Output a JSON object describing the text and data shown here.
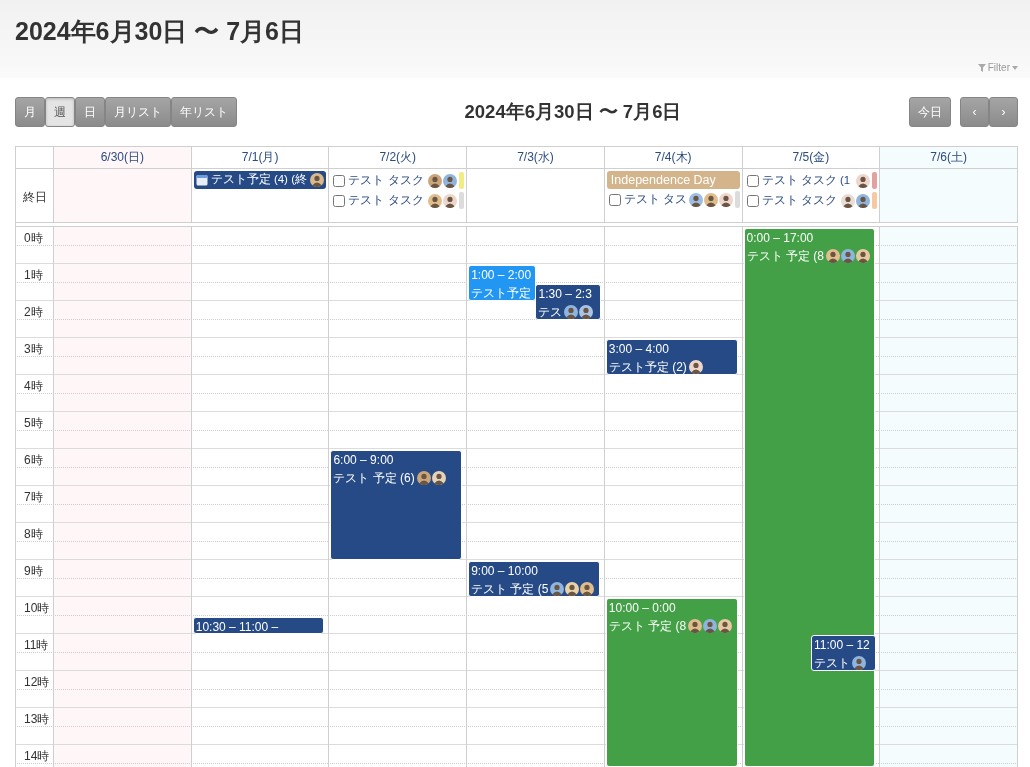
{
  "header": {
    "title": "2024年6月30日 〜 7月6日",
    "filter": "Filter"
  },
  "toolbar": {
    "views": [
      {
        "label": "月",
        "selected": false
      },
      {
        "label": "週",
        "selected": true
      },
      {
        "label": "日",
        "selected": false
      },
      {
        "label": "月リスト",
        "selected": false
      },
      {
        "label": "年リスト",
        "selected": false
      }
    ],
    "title": "2024年6月30日 〜 7月6日",
    "today": "今日",
    "nav": [
      "‹",
      "›"
    ]
  },
  "calendar": {
    "allday_label": "終日",
    "hours": [
      "0時",
      "1時",
      "2時",
      "3時",
      "4時",
      "5時",
      "6時",
      "7時",
      "8時",
      "9時",
      "10時",
      "11時",
      "12時",
      "13時",
      "14時"
    ],
    "days": [
      {
        "label": "6/30(日)",
        "kind": "sunday"
      },
      {
        "label": "7/1(月)",
        "kind": "weekday",
        "allday": [
          {
            "kind": "event",
            "title": "テスト予定 (4) (終",
            "color": "#254a86",
            "avatars": [
              {
                "color": "#d9b98c"
              }
            ]
          }
        ],
        "events": [
          {
            "time": "10:30 – 11:00 –",
            "color": "#254a86"
          }
        ]
      },
      {
        "label": "7/2(火)",
        "kind": "weekday",
        "allday": [
          {
            "kind": "task",
            "title": "テスト タスク",
            "checked": false,
            "color": "#f2ec84",
            "avatars": [
              {
                "color": "#caa57a"
              },
              {
                "color": "#8fb4de"
              }
            ]
          },
          {
            "kind": "task",
            "title": "テスト タスク",
            "checked": false,
            "color": "#dcdcdc",
            "avatars": [
              {
                "color": "#e0bd8c"
              },
              {
                "color": "#efd6cc"
              }
            ]
          }
        ],
        "events": [
          {
            "time": "6:00 – 9:00",
            "title": "テスト 予定 (6)",
            "color": "#254a86",
            "avatars": [
              {
                "color": "#caa57a"
              },
              {
                "color": "#e6d3b8"
              }
            ]
          }
        ]
      },
      {
        "label": "7/3(水)",
        "kind": "weekday",
        "events": [
          {
            "time": "1:00 – 2:00",
            "title": "テスト予定",
            "color": "#2196f3"
          },
          {
            "time": "1:30 – 2:3",
            "title": "テス",
            "color": "#254a86",
            "avatars": [
              {
                "color": "#8fb4de"
              },
              {
                "color": "#a9c4e4"
              }
            ]
          },
          {
            "time": "9:00 – 10:00",
            "title": "テスト 予定 (5",
            "color": "#254a86",
            "avatars": [
              {
                "color": "#8fb4de"
              },
              {
                "color": "#e9d2a8"
              },
              {
                "color": "#e0bd8c"
              }
            ]
          }
        ]
      },
      {
        "label": "7/4(木)",
        "kind": "weekday",
        "allday": [
          {
            "kind": "holiday",
            "title": "Independence Day",
            "color": "#d4b48b"
          },
          {
            "kind": "task",
            "title": "テスト タス",
            "checked": false,
            "color": "#dcdcdc",
            "avatars": [
              {
                "color": "#9dbde3"
              },
              {
                "color": "#e0bd8c"
              },
              {
                "color": "#efd6cc"
              }
            ]
          }
        ],
        "events": [
          {
            "time": "3:00 – 4:00",
            "title": "テスト予定 (2)",
            "color": "#254a86",
            "avatars": [
              {
                "color": "#efd6cc"
              }
            ]
          },
          {
            "time": "10:00 – 0:00",
            "title": "テスト 予定 (8",
            "color": "#43a047",
            "avatars": [
              {
                "color": "#e0bd8c"
              },
              {
                "color": "#8fb4de"
              },
              {
                "color": "#e6c9a0"
              }
            ]
          }
        ]
      },
      {
        "label": "7/5(金)",
        "kind": "weekday",
        "allday": [
          {
            "kind": "task",
            "title": "テスト タスク (1",
            "checked": false,
            "color": "#e3a2a2",
            "avatars": [
              {
                "color": "#efd6cc"
              }
            ]
          },
          {
            "kind": "task",
            "title": "テスト タスク",
            "checked": false,
            "color": "#f6c9a1",
            "avatars": [
              {
                "color": "#e9dcd4"
              },
              {
                "color": "#8fb4de"
              }
            ]
          }
        ],
        "events": [
          {
            "time": "0:00 – 17:00",
            "title": "テスト 予定 (8",
            "color": "#43a047",
            "avatars": [
              {
                "color": "#e0bd8c"
              },
              {
                "color": "#8fb4de"
              },
              {
                "color": "#e6c9a0"
              }
            ]
          },
          {
            "time": "11:00 – 12",
            "title": "テスト",
            "color": "#254a86",
            "avatars": [
              {
                "color": "#8fb4de"
              }
            ]
          }
        ]
      },
      {
        "label": "7/6(土)",
        "kind": "saturday"
      }
    ]
  }
}
